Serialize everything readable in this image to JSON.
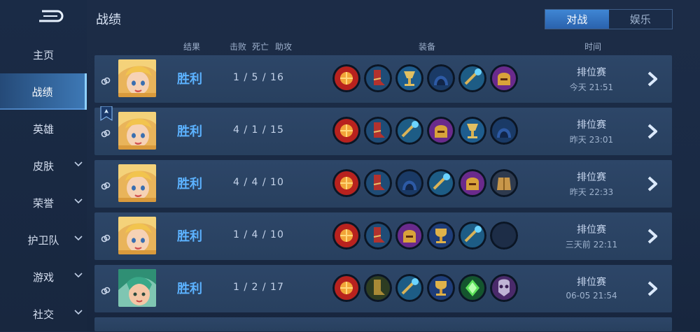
{
  "page_title": "战绩",
  "tabs": [
    {
      "label": "对战",
      "active": true
    },
    {
      "label": "娱乐",
      "active": false
    }
  ],
  "sidebar": {
    "items": [
      {
        "label": "主页",
        "has_chevron": false,
        "active": false
      },
      {
        "label": "战绩",
        "has_chevron": false,
        "active": true
      },
      {
        "label": "英雄",
        "has_chevron": false,
        "active": false
      },
      {
        "label": "皮肤",
        "has_chevron": true,
        "active": false
      },
      {
        "label": "荣誉",
        "has_chevron": true,
        "active": false
      },
      {
        "label": "护卫队",
        "has_chevron": true,
        "active": false
      },
      {
        "label": "游戏",
        "has_chevron": true,
        "active": false
      },
      {
        "label": "社交",
        "has_chevron": true,
        "active": false
      }
    ]
  },
  "columns": {
    "result": "结果",
    "kills": "击败",
    "deaths": "死亡",
    "assists": "助攻",
    "gear": "装备",
    "time": "时间"
  },
  "matches": [
    {
      "result": "胜利",
      "kda": "1 / 5 / 16",
      "mode": "排位赛",
      "time": "今天 21:51",
      "hero": "blonde-hero",
      "mvp": false,
      "items": [
        "sun-orb",
        "red-boots",
        "goblet",
        "hood",
        "blue-wand",
        "gold-helm"
      ]
    },
    {
      "result": "胜利",
      "kda": "4 / 1 / 15",
      "mode": "排位赛",
      "time": "昨天 23:01",
      "hero": "blonde-hero",
      "mvp": true,
      "items": [
        "sun-orb",
        "red-boots",
        "blue-wand",
        "gold-helm",
        "goblet",
        "hood"
      ]
    },
    {
      "result": "胜利",
      "kda": "4 / 4 / 10",
      "mode": "排位赛",
      "time": "昨天 22:33",
      "hero": "blonde-hero",
      "mvp": false,
      "items": [
        "sun-orb",
        "red-boots",
        "hood",
        "blue-wand",
        "gold-helm",
        "gold-armor"
      ]
    },
    {
      "result": "胜利",
      "kda": "1 / 4 / 10",
      "mode": "排位赛",
      "time": "三天前 22:11",
      "hero": "blonde-hero",
      "mvp": false,
      "items": [
        "sun-orb",
        "red-boots",
        "gold-helm",
        "trophy",
        "blue-wand",
        "empty"
      ]
    },
    {
      "result": "胜利",
      "kda": "1 / 2 / 17",
      "mode": "排位赛",
      "time": "06-05  21:54",
      "hero": "green-hero",
      "mvp": false,
      "items": [
        "sun-orb",
        "gold-boots",
        "blue-wand",
        "trophy",
        "green-gem",
        "skull-mask"
      ]
    }
  ],
  "colors": {
    "accent": "#5cb2ff",
    "row_bg": "#2b4465",
    "active_tab": "#3574c2"
  }
}
